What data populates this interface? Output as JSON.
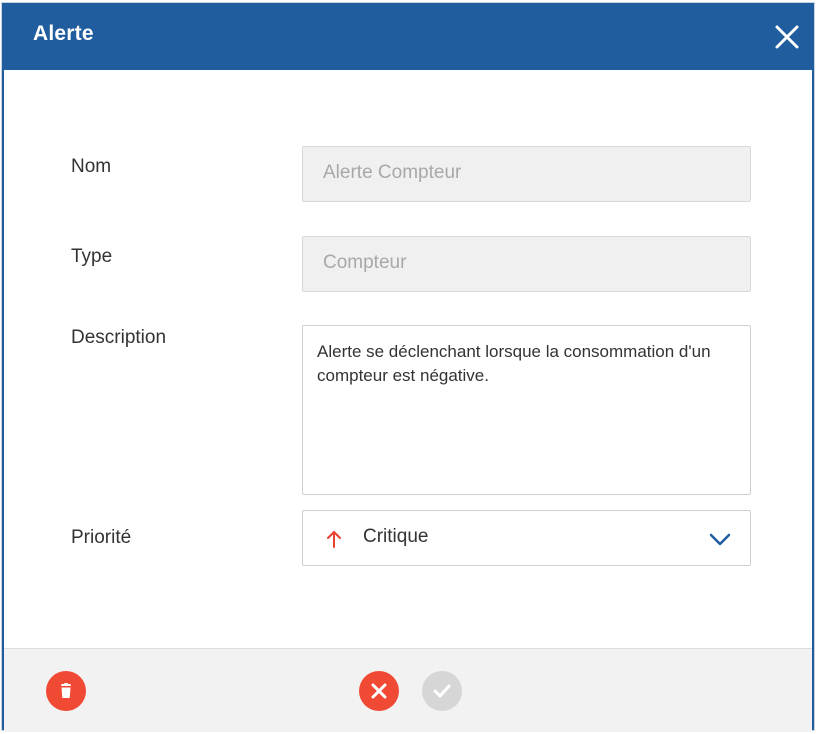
{
  "dialog": {
    "title": "Alerte",
    "close_icon": "close-icon"
  },
  "form": {
    "name": {
      "label": "Nom",
      "value": "Alerte Compteur"
    },
    "type": {
      "label": "Type",
      "value": "Compteur"
    },
    "description": {
      "label": "Description",
      "value": "Alerte se déclenchant lorsque la consommation d'un compteur est négative."
    },
    "priority": {
      "label": "Priorité",
      "value": "Critique",
      "icon": "arrow-up-icon",
      "icon_color": "#e8432f"
    }
  },
  "footer": {
    "delete_icon": "trash-icon",
    "cancel_icon": "x-icon",
    "confirm_icon": "check-icon"
  },
  "colors": {
    "header": "#1f5d9f",
    "danger": "#f04a35",
    "disabled": "#d6d6d6",
    "chevron": "#1f5d9f"
  }
}
